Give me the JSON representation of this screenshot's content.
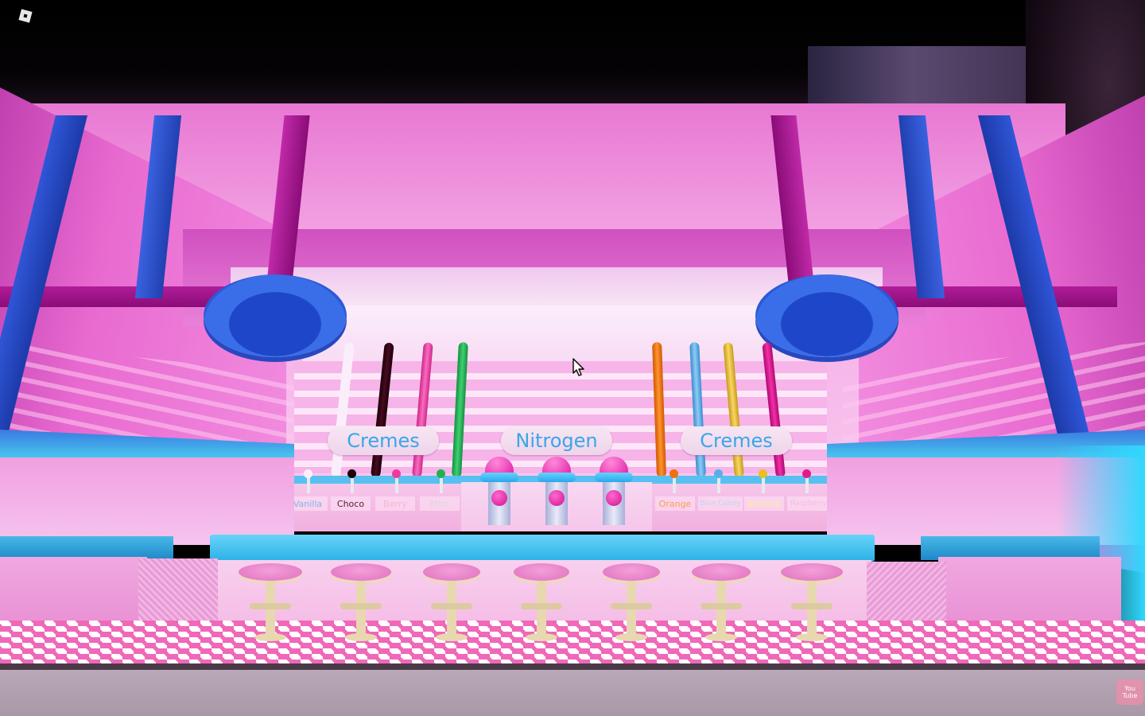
{
  "window": {
    "roblox_menu_icon": "roblox-logo-icon",
    "overlay_badge_icon": "youtube-icon",
    "overlay_badge_text": "You Tube"
  },
  "scene": {
    "signs": {
      "left": "Cremes",
      "center": "Nitrogen",
      "right": "Cremes"
    },
    "left_flavors": [
      {
        "label": "Vanilla",
        "color": "#ffffff",
        "text_color": "#7fb6ea"
      },
      {
        "label": "Choco",
        "color": "#2a0210",
        "text_color": "#5a1b2a"
      },
      {
        "label": "Berry",
        "color": "#ee3c9c",
        "text_color": "#f4b6d4"
      },
      {
        "label": "Mint",
        "color": "#24b04c",
        "text_color": "#d9d9d9"
      }
    ],
    "right_flavors": [
      {
        "label": "Orange",
        "color": "#f07010",
        "text_color": "#f4a24a"
      },
      {
        "label": "Blue Candy",
        "color": "#5aaee8",
        "text_color": "#bcd7f2"
      },
      {
        "label": "Banana",
        "color": "#e8b830",
        "text_color": "#ffe8a0"
      },
      {
        "label": "Raspberry",
        "color": "#e01a8a",
        "text_color": "#f0c0dc"
      }
    ],
    "nitrogen_dispensers": 3,
    "stools": 7
  },
  "colors": {
    "wall_pink": "#f07ad6",
    "ceiling_pink": "#e060c8",
    "beam_blue": "#2a4ec8",
    "beam_purple": "#a0108a",
    "counter_blue": "#48c8f0",
    "floor_pink": "#f068b8",
    "stool_seat": "#ee80c8",
    "stool_base": "#e8d8b0"
  }
}
